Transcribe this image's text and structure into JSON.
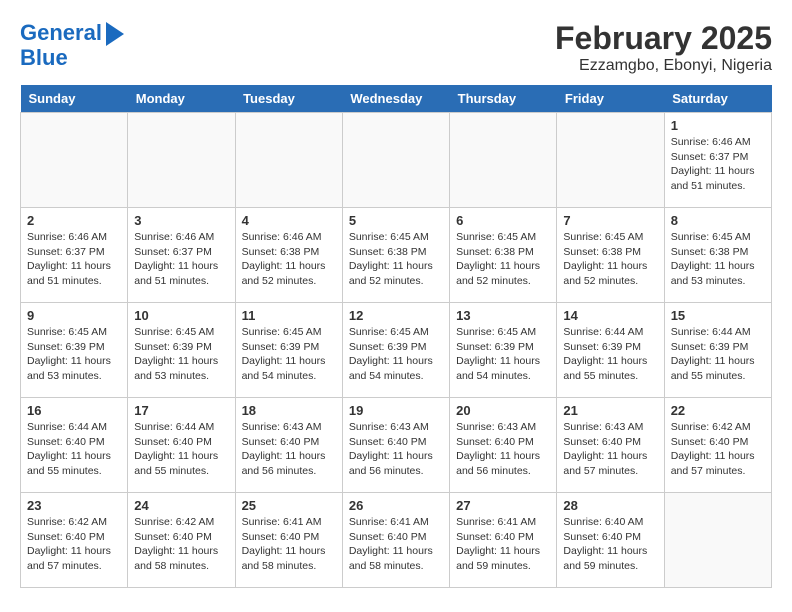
{
  "header": {
    "logo_line1": "General",
    "logo_line2": "Blue",
    "month": "February 2025",
    "location": "Ezzamgbo, Ebonyi, Nigeria"
  },
  "days_of_week": [
    "Sunday",
    "Monday",
    "Tuesday",
    "Wednesday",
    "Thursday",
    "Friday",
    "Saturday"
  ],
  "weeks": [
    [
      {
        "day": "",
        "info": ""
      },
      {
        "day": "",
        "info": ""
      },
      {
        "day": "",
        "info": ""
      },
      {
        "day": "",
        "info": ""
      },
      {
        "day": "",
        "info": ""
      },
      {
        "day": "",
        "info": ""
      },
      {
        "day": "1",
        "info": "Sunrise: 6:46 AM\nSunset: 6:37 PM\nDaylight: 11 hours and 51 minutes."
      }
    ],
    [
      {
        "day": "2",
        "info": "Sunrise: 6:46 AM\nSunset: 6:37 PM\nDaylight: 11 hours and 51 minutes."
      },
      {
        "day": "3",
        "info": "Sunrise: 6:46 AM\nSunset: 6:37 PM\nDaylight: 11 hours and 51 minutes."
      },
      {
        "day": "4",
        "info": "Sunrise: 6:46 AM\nSunset: 6:38 PM\nDaylight: 11 hours and 52 minutes."
      },
      {
        "day": "5",
        "info": "Sunrise: 6:45 AM\nSunset: 6:38 PM\nDaylight: 11 hours and 52 minutes."
      },
      {
        "day": "6",
        "info": "Sunrise: 6:45 AM\nSunset: 6:38 PM\nDaylight: 11 hours and 52 minutes."
      },
      {
        "day": "7",
        "info": "Sunrise: 6:45 AM\nSunset: 6:38 PM\nDaylight: 11 hours and 52 minutes."
      },
      {
        "day": "8",
        "info": "Sunrise: 6:45 AM\nSunset: 6:38 PM\nDaylight: 11 hours and 53 minutes."
      }
    ],
    [
      {
        "day": "9",
        "info": "Sunrise: 6:45 AM\nSunset: 6:39 PM\nDaylight: 11 hours and 53 minutes."
      },
      {
        "day": "10",
        "info": "Sunrise: 6:45 AM\nSunset: 6:39 PM\nDaylight: 11 hours and 53 minutes."
      },
      {
        "day": "11",
        "info": "Sunrise: 6:45 AM\nSunset: 6:39 PM\nDaylight: 11 hours and 54 minutes."
      },
      {
        "day": "12",
        "info": "Sunrise: 6:45 AM\nSunset: 6:39 PM\nDaylight: 11 hours and 54 minutes."
      },
      {
        "day": "13",
        "info": "Sunrise: 6:45 AM\nSunset: 6:39 PM\nDaylight: 11 hours and 54 minutes."
      },
      {
        "day": "14",
        "info": "Sunrise: 6:44 AM\nSunset: 6:39 PM\nDaylight: 11 hours and 55 minutes."
      },
      {
        "day": "15",
        "info": "Sunrise: 6:44 AM\nSunset: 6:39 PM\nDaylight: 11 hours and 55 minutes."
      }
    ],
    [
      {
        "day": "16",
        "info": "Sunrise: 6:44 AM\nSunset: 6:40 PM\nDaylight: 11 hours and 55 minutes."
      },
      {
        "day": "17",
        "info": "Sunrise: 6:44 AM\nSunset: 6:40 PM\nDaylight: 11 hours and 55 minutes."
      },
      {
        "day": "18",
        "info": "Sunrise: 6:43 AM\nSunset: 6:40 PM\nDaylight: 11 hours and 56 minutes."
      },
      {
        "day": "19",
        "info": "Sunrise: 6:43 AM\nSunset: 6:40 PM\nDaylight: 11 hours and 56 minutes."
      },
      {
        "day": "20",
        "info": "Sunrise: 6:43 AM\nSunset: 6:40 PM\nDaylight: 11 hours and 56 minutes."
      },
      {
        "day": "21",
        "info": "Sunrise: 6:43 AM\nSunset: 6:40 PM\nDaylight: 11 hours and 57 minutes."
      },
      {
        "day": "22",
        "info": "Sunrise: 6:42 AM\nSunset: 6:40 PM\nDaylight: 11 hours and 57 minutes."
      }
    ],
    [
      {
        "day": "23",
        "info": "Sunrise: 6:42 AM\nSunset: 6:40 PM\nDaylight: 11 hours and 57 minutes."
      },
      {
        "day": "24",
        "info": "Sunrise: 6:42 AM\nSunset: 6:40 PM\nDaylight: 11 hours and 58 minutes."
      },
      {
        "day": "25",
        "info": "Sunrise: 6:41 AM\nSunset: 6:40 PM\nDaylight: 11 hours and 58 minutes."
      },
      {
        "day": "26",
        "info": "Sunrise: 6:41 AM\nSunset: 6:40 PM\nDaylight: 11 hours and 58 minutes."
      },
      {
        "day": "27",
        "info": "Sunrise: 6:41 AM\nSunset: 6:40 PM\nDaylight: 11 hours and 59 minutes."
      },
      {
        "day": "28",
        "info": "Sunrise: 6:40 AM\nSunset: 6:40 PM\nDaylight: 11 hours and 59 minutes."
      },
      {
        "day": "",
        "info": ""
      }
    ]
  ]
}
